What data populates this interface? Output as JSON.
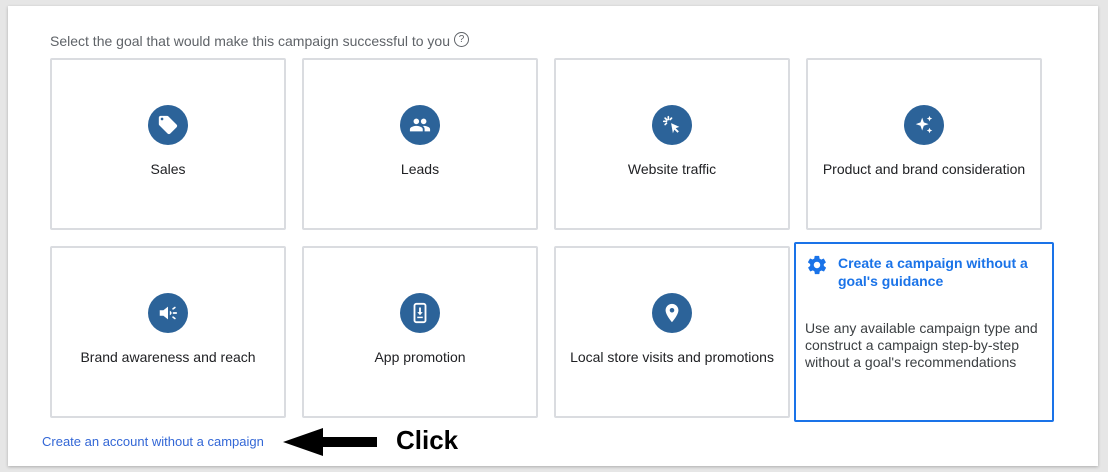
{
  "prompt": {
    "text": "Select the goal that would make this campaign successful to you",
    "help_icon": "?"
  },
  "goals": [
    {
      "label": "Sales",
      "icon": "tag-icon"
    },
    {
      "label": "Leads",
      "icon": "people-icon"
    },
    {
      "label": "Website traffic",
      "icon": "cursor-click-icon"
    },
    {
      "label": "Product and brand consideration",
      "icon": "sparkle-icon"
    },
    {
      "label": "Brand awareness and reach",
      "icon": "megaphone-icon"
    },
    {
      "label": "App promotion",
      "icon": "phone-download-icon"
    },
    {
      "label": "Local store visits and promotions",
      "icon": "location-pin-icon"
    }
  ],
  "no_goal_card": {
    "title": "Create a campaign without a goal's guidance",
    "description": "Use any available campaign type and construct a campaign step-by-step without a goal's recommendations",
    "icon": "gear-icon"
  },
  "footer_link": "Create an account without a campaign",
  "annotation": {
    "label": "Click",
    "icon": "left-arrow-icon"
  },
  "colors": {
    "icon_circle": "#2c6399",
    "accent": "#1a73e8",
    "link": "#3367d6",
    "border": "#dadce0"
  }
}
